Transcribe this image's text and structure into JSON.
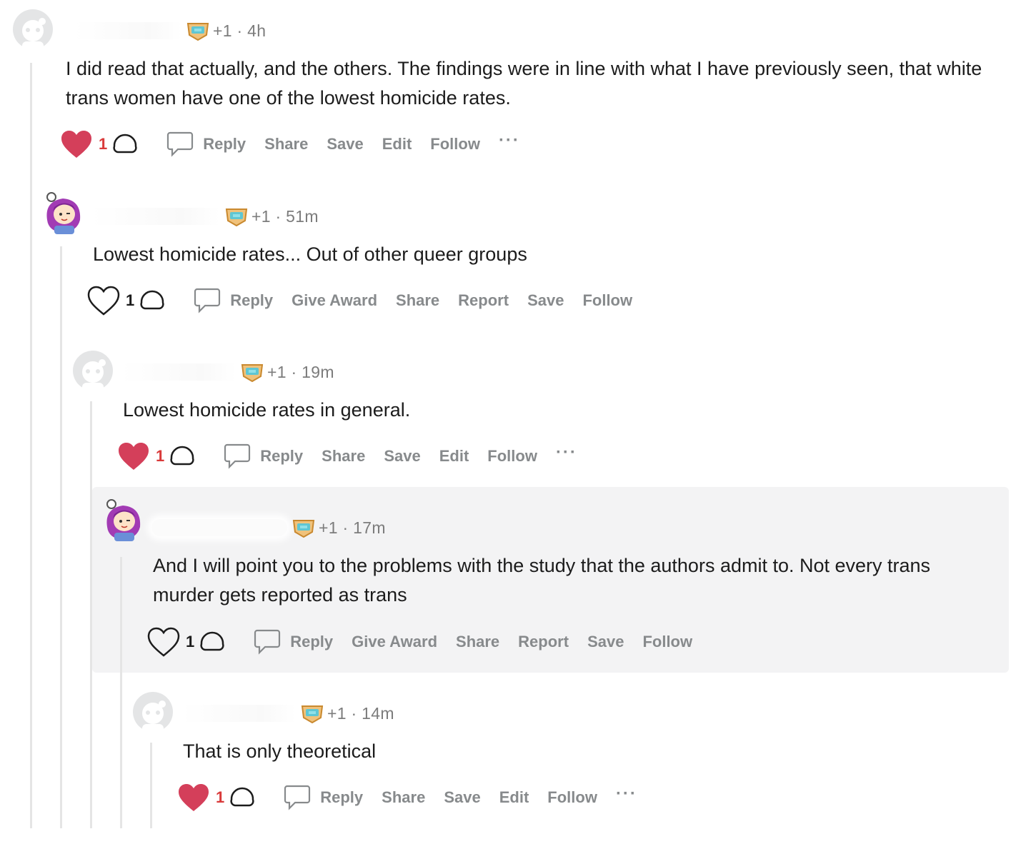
{
  "comments": [
    {
      "score_meta": "+1 · 4h",
      "text": "I did read that actually, and the others. The findings were in line with what I have previously seen, that white trans women have one of the lowest homicide rates.",
      "votes": "1",
      "liked": true,
      "actions": {
        "reply": "Reply",
        "share": "Share",
        "save": "Save",
        "edit": "Edit",
        "follow": "Follow",
        "more": "···"
      }
    },
    {
      "score_meta": "+1 · 51m",
      "text": "Lowest homicide rates... Out of other queer groups",
      "votes": "1",
      "liked": false,
      "actions": {
        "reply": "Reply",
        "give_award": "Give Award",
        "share": "Share",
        "report": "Report",
        "save": "Save",
        "follow": "Follow"
      }
    },
    {
      "score_meta": "+1 · 19m",
      "text": "Lowest homicide rates in general.",
      "votes": "1",
      "liked": true,
      "actions": {
        "reply": "Reply",
        "share": "Share",
        "save": "Save",
        "edit": "Edit",
        "follow": "Follow",
        "more": "···"
      }
    },
    {
      "score_meta": "+1 · 17m",
      "text": "And I will point you to the problems with the study that the authors admit to. Not every trans murder gets reported as trans",
      "votes": "1",
      "liked": false,
      "actions": {
        "reply": "Reply",
        "give_award": "Give Award",
        "share": "Share",
        "report": "Report",
        "save": "Save",
        "follow": "Follow"
      }
    },
    {
      "score_meta": "+1 · 14m",
      "text": "That is only theoretical",
      "votes": "1",
      "liked": true,
      "actions": {
        "reply": "Reply",
        "share": "Share",
        "save": "Save",
        "edit": "Edit",
        "follow": "Follow",
        "more": "···"
      }
    }
  ],
  "colors": {
    "heart_red": "#d43f5a",
    "count_red": "#d93a3a",
    "action_grey": "#878a8c",
    "highlight_bg": "#f3f3f4",
    "avatar_purple": "#a23bb4"
  },
  "icons": [
    "default-avatar-icon",
    "anime-avatar-icon",
    "flair-badge-icon",
    "heart-icon",
    "upvote-icon",
    "comment-bubble-icon",
    "more-options-icon"
  ]
}
